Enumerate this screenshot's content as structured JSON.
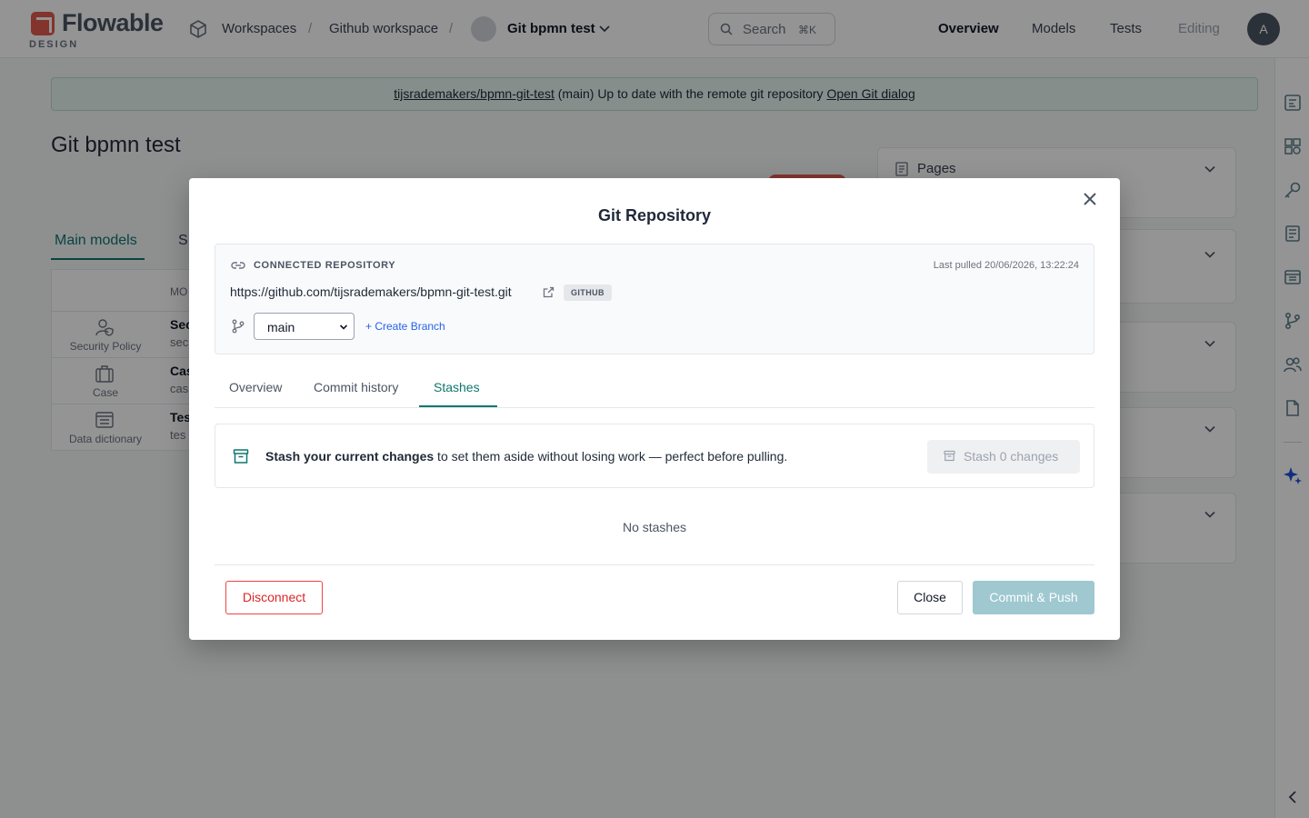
{
  "app": {
    "logo_word": "Flowable",
    "logo_sub": "DESIGN",
    "breadcrumb": {
      "workspaces": "Workspaces",
      "workspace": "Github workspace",
      "project": "Git bpmn test",
      "separator": "/"
    },
    "search": {
      "placeholder": "Search",
      "shortcut": "⌘K"
    },
    "nav": {
      "overview": "Overview",
      "models": "Models",
      "tests": "Tests",
      "editing": "Editing"
    },
    "user_initial": "A"
  },
  "banner": {
    "repo": "tijsrademakers/bpmn-git-test",
    "message": " (main) Up to date with the remote git repository ",
    "link": "Open Git dialog"
  },
  "page": {
    "title": "Git bpmn test",
    "tab_main": "Main models",
    "tab_second": "S",
    "table_header": "MO",
    "rows": [
      {
        "type": "Security Policy",
        "name": "Sec",
        "sub": "sec"
      },
      {
        "type": "Case",
        "name": "Cas",
        "sub": "cas"
      },
      {
        "type": "Data dictionary",
        "name": "Tes",
        "sub": "tes"
      }
    ],
    "side_pages": "Pages"
  },
  "modal": {
    "title": "Git Repository",
    "repo": {
      "heading": "CONNECTED REPOSITORY",
      "last_pulled": "Last pulled 20/06/2026, 13:22:24",
      "url": "https://github.com/tijsrademakers/bpmn-git-test.git",
      "provider": "GITHUB",
      "branch": "main",
      "create_branch": "+ Create Branch"
    },
    "tabs": {
      "overview": "Overview",
      "history": "Commit history",
      "stashes": "Stashes",
      "active": "Stashes"
    },
    "stash": {
      "bold": "Stash your current changes",
      "rest": " to set them aside without losing work — perfect before pulling.",
      "button": "Stash 0 changes",
      "empty": "No stashes"
    },
    "footer": {
      "disconnect": "Disconnect",
      "close": "Close",
      "commit_push": "Commit & Push"
    }
  },
  "colors": {
    "accent": "#0f766e",
    "link": "#2563eb",
    "danger": "#dc2626",
    "primary_disabled": "#9fc8d1",
    "brand": "#e05b4f"
  }
}
